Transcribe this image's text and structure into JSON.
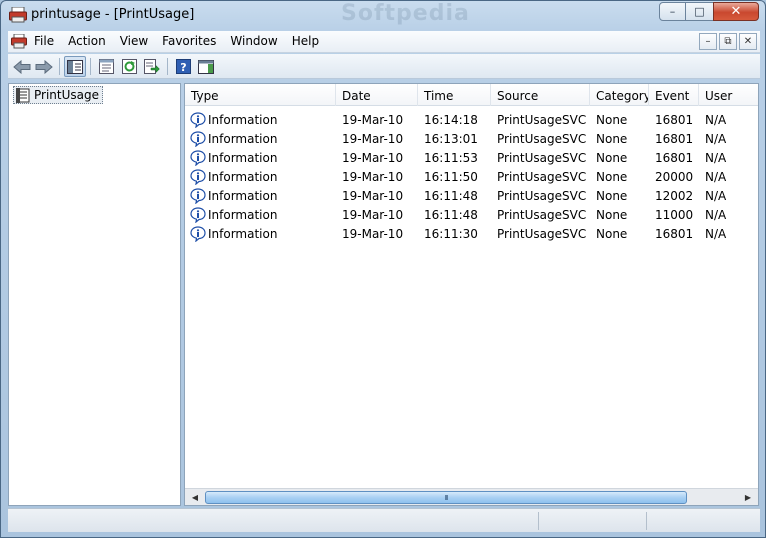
{
  "window": {
    "title": "printusage - [PrintUsage]",
    "watermark": "Softpedia",
    "controls": {
      "minimize": "–",
      "maximize": "□",
      "close": "✕"
    }
  },
  "menubar": {
    "items": [
      "File",
      "Action",
      "View",
      "Favorites",
      "Window",
      "Help"
    ],
    "child_controls": {
      "minimize": "–",
      "restore": "⧉",
      "close": "✕"
    }
  },
  "toolbar": {
    "buttons": [
      "back-icon",
      "forward-icon",
      "show-hide-tree-icon",
      "properties-icon",
      "refresh-icon",
      "export-list-icon",
      "help-icon",
      "show-action-pane-icon"
    ]
  },
  "tree": {
    "root_label": "PrintUsage"
  },
  "list": {
    "columns": [
      "Type",
      "Date",
      "Time",
      "Source",
      "Category",
      "Event",
      "User"
    ],
    "rows": [
      {
        "type": "Information",
        "date": "19-Mar-10",
        "time": "16:14:18",
        "source": "PrintUsageSVC",
        "category": "None",
        "event": "16801",
        "user": "N/A"
      },
      {
        "type": "Information",
        "date": "19-Mar-10",
        "time": "16:13:01",
        "source": "PrintUsageSVC",
        "category": "None",
        "event": "16801",
        "user": "N/A"
      },
      {
        "type": "Information",
        "date": "19-Mar-10",
        "time": "16:11:53",
        "source": "PrintUsageSVC",
        "category": "None",
        "event": "16801",
        "user": "N/A"
      },
      {
        "type": "Information",
        "date": "19-Mar-10",
        "time": "16:11:50",
        "source": "PrintUsageSVC",
        "category": "None",
        "event": "20000",
        "user": "N/A"
      },
      {
        "type": "Information",
        "date": "19-Mar-10",
        "time": "16:11:48",
        "source": "PrintUsageSVC",
        "category": "None",
        "event": "12002",
        "user": "N/A"
      },
      {
        "type": "Information",
        "date": "19-Mar-10",
        "time": "16:11:48",
        "source": "PrintUsageSVC",
        "category": "None",
        "event": "11000",
        "user": "N/A"
      },
      {
        "type": "Information",
        "date": "19-Mar-10",
        "time": "16:11:30",
        "source": "PrintUsageSVC",
        "category": "None",
        "event": "16801",
        "user": "N/A"
      }
    ]
  },
  "scrollbar": {
    "grip": "III",
    "left_arrow": "◀",
    "right_arrow": "▶"
  },
  "colors": {
    "title_gradient_top": "#c9dcee",
    "close_button": "#c9482f",
    "scroll_thumb": "#a9d0f3",
    "info_icon": "#1f4fa8"
  }
}
